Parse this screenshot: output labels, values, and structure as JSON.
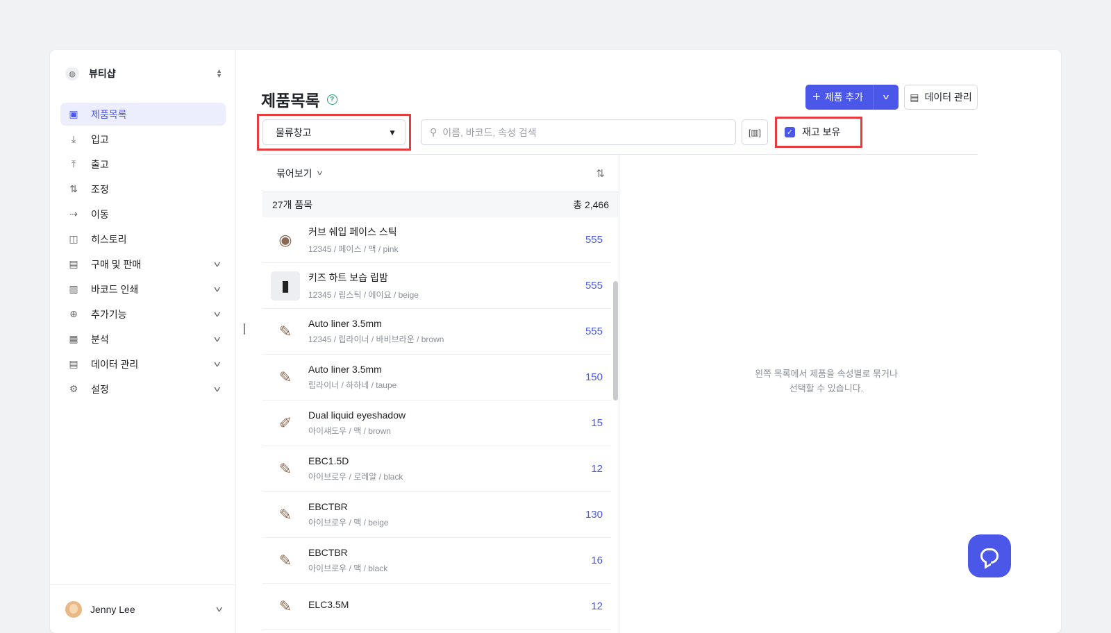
{
  "workspace": {
    "name": "뷰티샵",
    "logo_icon": "globe-icon"
  },
  "sidebar": {
    "items": [
      {
        "label": "제품목록",
        "icon": "box-icon",
        "glyph": "▣",
        "active": true,
        "expandable": false
      },
      {
        "label": "입고",
        "icon": "arrow-down-icon",
        "glyph": "⤓",
        "active": false,
        "expandable": false
      },
      {
        "label": "출고",
        "icon": "arrow-up-icon",
        "glyph": "⤒",
        "active": false,
        "expandable": false
      },
      {
        "label": "조정",
        "icon": "swap-icon",
        "glyph": "⇅",
        "active": false,
        "expandable": false
      },
      {
        "label": "이동",
        "icon": "arrow-right-icon",
        "glyph": "⇢",
        "active": false,
        "expandable": false
      },
      {
        "label": "히스토리",
        "icon": "history-icon",
        "glyph": "◫",
        "active": false,
        "expandable": false
      },
      {
        "label": "구매 및 판매",
        "icon": "document-icon",
        "glyph": "▤",
        "active": false,
        "expandable": true
      },
      {
        "label": "바코드 인쇄",
        "icon": "barcode-icon",
        "glyph": "▥",
        "active": false,
        "expandable": true
      },
      {
        "label": "추가기능",
        "icon": "plus-circle-icon",
        "glyph": "⊕",
        "active": false,
        "expandable": true
      },
      {
        "label": "분석",
        "icon": "chart-icon",
        "glyph": "▦",
        "active": false,
        "expandable": true
      },
      {
        "label": "데이터 관리",
        "icon": "database-icon",
        "glyph": "▤",
        "active": false,
        "expandable": true
      },
      {
        "label": "설정",
        "icon": "gear-icon",
        "glyph": "⚙",
        "active": false,
        "expandable": true
      }
    ]
  },
  "user": {
    "name": "Jenny Lee"
  },
  "page": {
    "title": "제품목록"
  },
  "toolbar": {
    "add_label": "제품 추가",
    "data_label": "데이터 관리"
  },
  "filters": {
    "warehouse": "물류창고",
    "search_placeholder": "이름, 바코드, 속성 검색",
    "in_stock_label": "재고 보유",
    "in_stock_checked": true
  },
  "list": {
    "group_label": "묶어보기",
    "count_label": "27개 품목",
    "total_label": "총 2,466",
    "items": [
      {
        "name": "커브 쉐입 페이스 스틱",
        "meta": "12345 / 페이스 / 맥 / pink",
        "qty": "555",
        "thumb": "lipstick-cap-icon",
        "glyph": "◉"
      },
      {
        "name": "키즈 하트 보습 립밤",
        "meta": "12345 / 립스틱 / 에이요 / beige",
        "qty": "555",
        "thumb": "lipstick-icon",
        "glyph": "▮"
      },
      {
        "name": "Auto liner 3.5mm",
        "meta": "12345 / 립라이너 / 바비브라운 / brown",
        "qty": "555",
        "thumb": "pencil-icon",
        "glyph": "✎"
      },
      {
        "name": "Auto liner 3.5mm",
        "meta": "립라이너 / 하하네 / taupe",
        "qty": "150",
        "thumb": "pencil-icon",
        "glyph": "✎"
      },
      {
        "name": "Dual liquid eyeshadow",
        "meta": "아이섀도우 / 맥 / brown",
        "qty": "15",
        "thumb": "applicator-icon",
        "glyph": "✐"
      },
      {
        "name": "EBC1.5D",
        "meta": "아이브로우 / 로레알 / black",
        "qty": "12",
        "thumb": "pencil-icon",
        "glyph": "✎"
      },
      {
        "name": "EBCTBR",
        "meta": "아이브로우 / 맥 / beige",
        "qty": "130",
        "thumb": "pencil-icon",
        "glyph": "✎"
      },
      {
        "name": "EBCTBR",
        "meta": "아이브로우 / 맥 / black",
        "qty": "16",
        "thumb": "pencil-icon",
        "glyph": "✎"
      },
      {
        "name": "ELC3.5M",
        "meta": "",
        "qty": "12",
        "thumb": "pencil-icon",
        "glyph": "✎"
      }
    ]
  },
  "detail": {
    "empty_line1": "왼쪽 목록에서 제품을 속성별로 묶거나",
    "empty_line2": "선택할 수 있습니다."
  },
  "colors": {
    "accent": "#4a57e8",
    "highlight": "#e33d3d",
    "help": "#1aa56a"
  }
}
